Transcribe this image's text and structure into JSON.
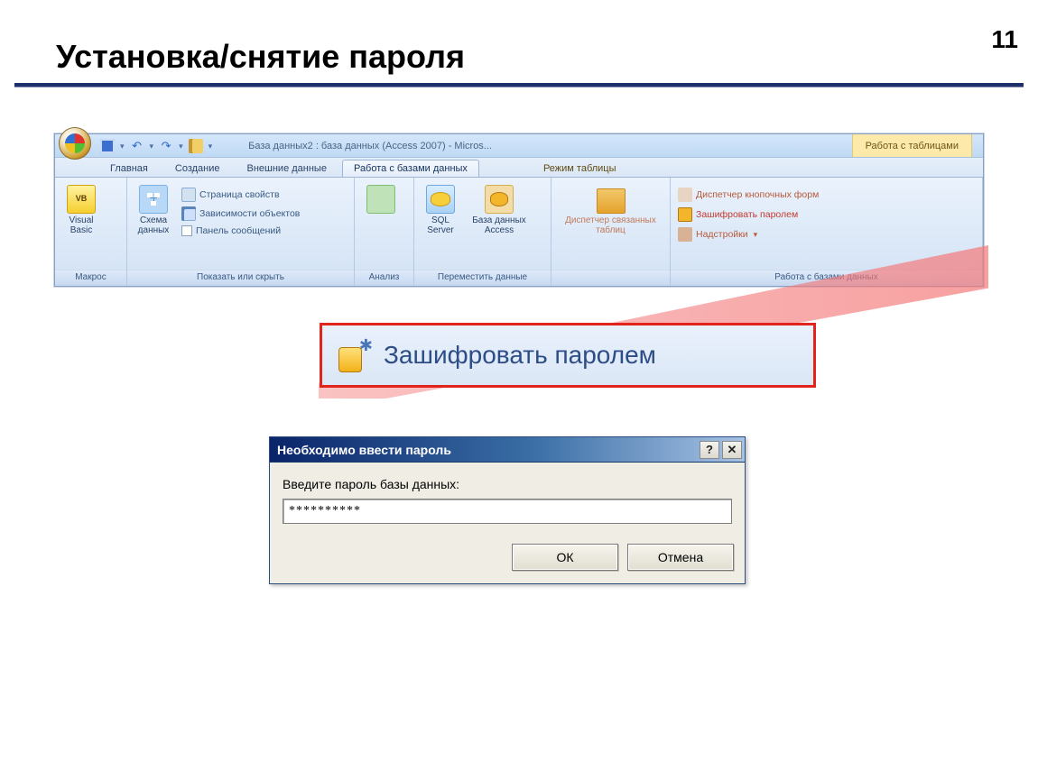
{
  "slide": {
    "title": "Установка/снятие пароля",
    "number": "11"
  },
  "app": {
    "title": "База данных2 : база данных (Access 2007) - Micros...",
    "context_tab_group": "Работа с таблицами"
  },
  "tabs": {
    "home": "Главная",
    "create": "Создание",
    "external": "Внешние данные",
    "dbtools": "Работа с базами данных",
    "datasheet": "Режим таблицы"
  },
  "ribbon": {
    "macros": {
      "visual_basic": "Visual Basic",
      "group_label": "Макрос"
    },
    "show": {
      "schema": "Схема данных",
      "prop_page": "Страница свойств",
      "dependencies": "Зависимости объектов",
      "msg_panel": "Панель сообщений",
      "group_label": "Показать или скрыть"
    },
    "analyze": {
      "group_label": "Анализ"
    },
    "move": {
      "sql_server": "SQL Server",
      "access_db": "База данных Access",
      "group_label": "Переместить данные"
    },
    "linkmgr": {
      "label": "Диспетчер связанных таблиц"
    },
    "dbtools_grp": {
      "switchboard": "Диспетчер кнопочных форм",
      "encrypt": "Зашифровать паролем",
      "addins": "Надстройки",
      "group_label": "Работа с базами данных"
    }
  },
  "callout": {
    "text": "Зашифровать паролем"
  },
  "dialog": {
    "title": "Необходимо ввести пароль",
    "label": "Введите пароль базы данных:",
    "value": "**********",
    "ok": "ОК",
    "cancel": "Отмена"
  }
}
